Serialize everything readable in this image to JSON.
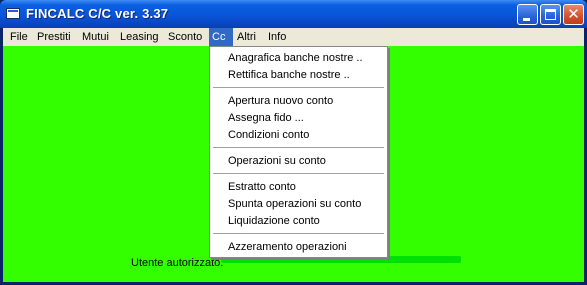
{
  "window": {
    "title": "FINCALC C/C ver. 3.37"
  },
  "menubar": {
    "items": [
      "File",
      "Prestiti",
      "Mutui",
      "Leasing",
      "Sconto",
      "Cc",
      "Altri",
      "Info"
    ],
    "active": "Cc"
  },
  "dropdown": {
    "items": [
      "Anagrafica banche nostre ..",
      "Rettifica banche nostre ..",
      "Apertura nuovo conto",
      "Assegna fido ...",
      "Condizioni conto",
      "Operazioni su conto",
      "Estratto conto",
      "Spunta operazioni su conto",
      "Liquidazione conto",
      "Azzeramento operazioni"
    ]
  },
  "status": {
    "user_label": "Utente autorizzato:"
  },
  "colors": {
    "client_bg": "#33ff00",
    "menu_highlight": "#316ac5",
    "titlebar": "#0a54d8"
  },
  "icons": {
    "app": "window-icon",
    "minimize": "minimize-icon",
    "maximize": "maximize-icon",
    "close": "close-icon"
  }
}
